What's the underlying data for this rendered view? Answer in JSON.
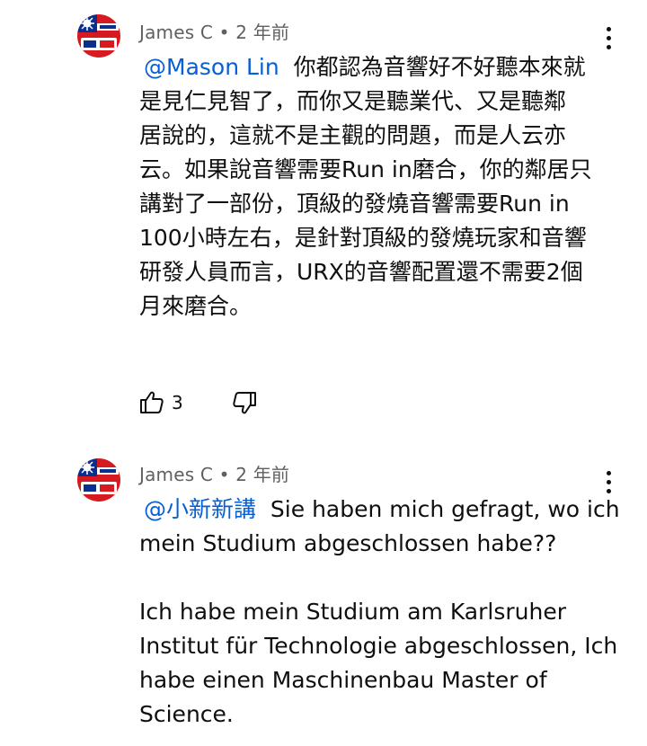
{
  "comments": [
    {
      "author": "James C",
      "separator": "•",
      "time": "2 年前",
      "mention": "@Mason Lin",
      "lines": [
        "你都認為音響好不好聽本來就",
        "是見仁見智了，而你又是聽業代、又是聽鄰",
        "居說的，這就不是主觀的問題，而是人云亦",
        "云。如果說音響需要Run in磨合，你的鄰居只",
        "講對了一部份，頂級的發燒音響需要Run in",
        "100小時左右，是針對頂級的發燒玩家和音響",
        "研發人員而言，URX的音響配置還不需要2個",
        "月來磨合。"
      ],
      "likes": "3",
      "avatar_icon": "flag-avatar-icon",
      "avatar_colors": {
        "red": "#d71920",
        "blue": "#0a2f8f",
        "white": "#ffffff"
      }
    },
    {
      "author": "James C",
      "separator": "•",
      "time": "2 年前",
      "mention": "@小新新講",
      "lines": [
        "Sie haben mich gefragt, wo ich",
        "mein Studium abgeschlossen habe??",
        "",
        "Ich habe mein Studium am Karlsruher",
        "Institut für Technologie abgeschlossen,  Ich",
        "habe einen Maschinenbau Master of",
        "Science."
      ],
      "avatar_icon": "flag-avatar-icon",
      "avatar_colors": {
        "red": "#d71920",
        "blue": "#0a2f8f",
        "white": "#ffffff"
      }
    }
  ],
  "icons": {
    "like": "thumb-up-icon",
    "dislike": "thumb-down-icon",
    "menu": "more-vert-icon"
  },
  "colors": {
    "mention": "#065fd4",
    "meta": "#606060",
    "text": "#0f0f0f"
  }
}
